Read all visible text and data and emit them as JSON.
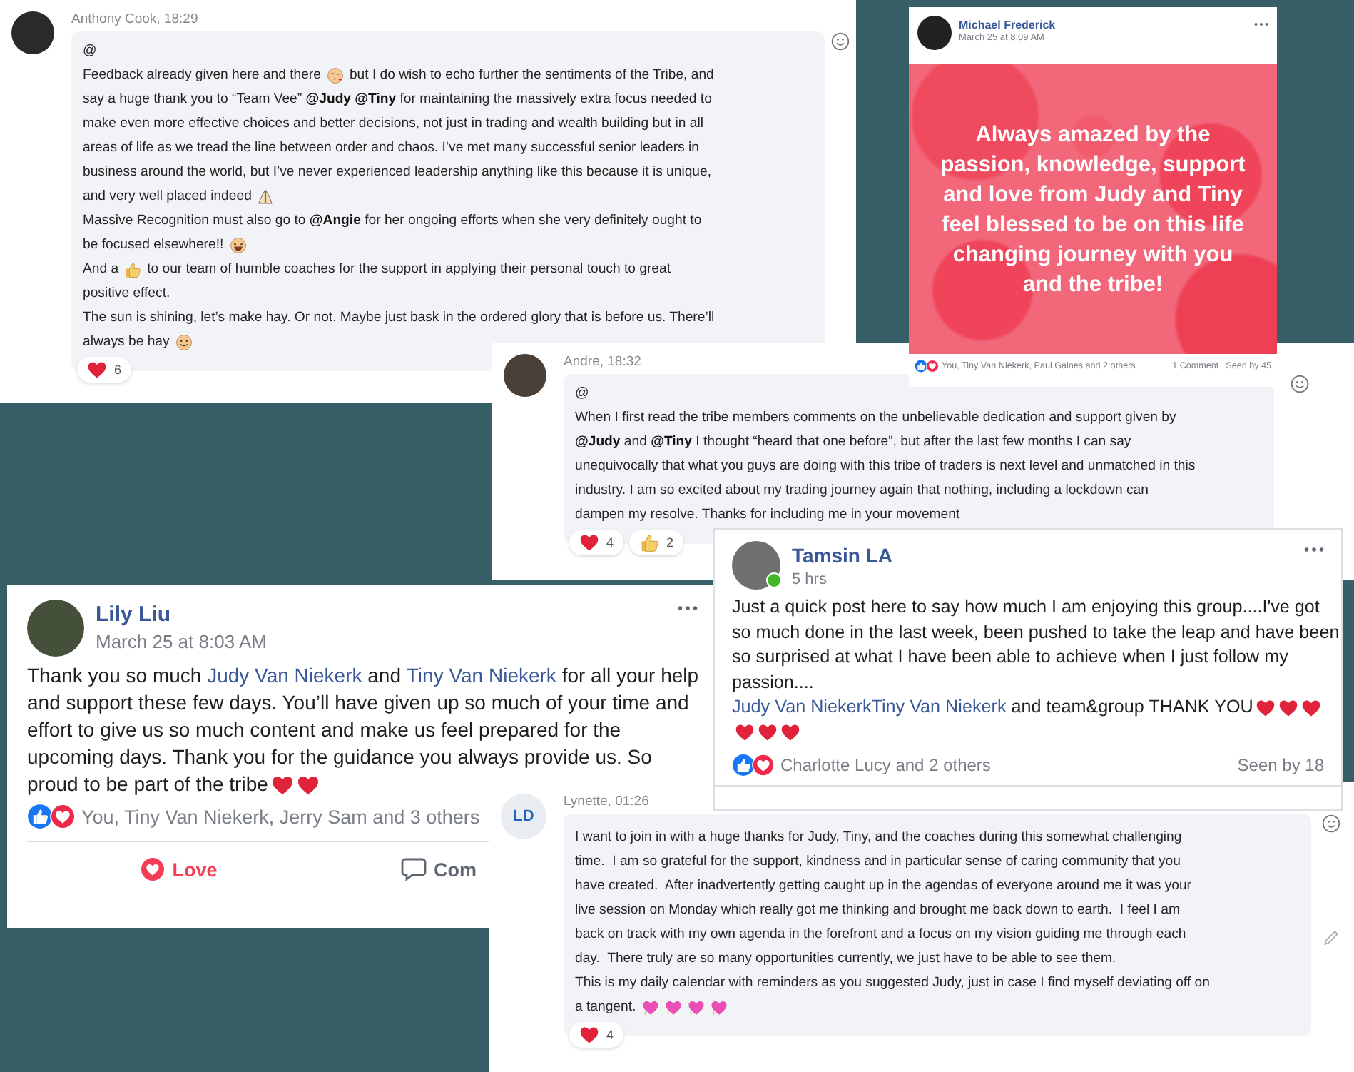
{
  "posts": [
    {
      "kind": "chat",
      "author": "Anthony Cook, 18:29",
      "lines": [
        [
          {
            "kind": "text",
            "text": "@"
          }
        ],
        [
          {
            "kind": "text",
            "text": "Feedback already given here and there"
          },
          {
            "kind": "kiss"
          },
          {
            "kind": "text",
            "text": "but I do wish to echo further the sentiments of the Tribe, and"
          }
        ],
        [
          {
            "kind": "text",
            "text": "say a huge thank you to “Team Vee” **@Judy @Tiny** for maintaining the massively extra focus needed to"
          }
        ],
        [
          {
            "kind": "text",
            "text": "make even more effective choices and better decisions, not just in trading and wealth building but in all"
          }
        ],
        [
          {
            "kind": "text",
            "text": "areas of life as we tread the line between order and chaos. I’ve met many successful senior leaders in"
          }
        ],
        [
          {
            "kind": "text",
            "text": "business around the world, but I’ve never experienced leadership anything like this because it is unique,"
          }
        ],
        [
          {
            "kind": "text",
            "text": "and very well placed indeed"
          },
          {
            "kind": "pray"
          }
        ],
        [
          {
            "kind": "text",
            "text": "Massive Recognition must also go to **@Angie** for her ongoing efforts when she very definitely ought to"
          }
        ],
        [
          {
            "kind": "text",
            "text": "be focused elsewhere!!"
          },
          {
            "kind": "laugh"
          }
        ],
        [
          {
            "kind": "text",
            "text": "And a"
          },
          {
            "kind": "thumb"
          },
          {
            "kind": "text",
            "text": "to our team of humble coaches for the support in applying their personal touch to great"
          }
        ],
        [
          {
            "kind": "text",
            "text": "positive effect."
          }
        ],
        [
          {
            "kind": "text",
            "text": "The sun is shining, let’s make hay. Or not. Maybe just bask in the ordered glory that is before us. There’ll"
          }
        ],
        [
          {
            "kind": "text",
            "text": "always be hay"
          },
          {
            "kind": "smile"
          }
        ]
      ],
      "reactions": [
        {
          "kind": "heart",
          "count": "6"
        }
      ]
    },
    {
      "kind": "chat",
      "author": "Andre, 18:32",
      "lines": [
        [
          {
            "kind": "text",
            "text": "@"
          }
        ],
        [
          {
            "kind": "text",
            "text": "When I first read the tribe members comments on the unbelievable dedication and support given by"
          }
        ],
        [
          {
            "kind": "text",
            "text": "**@Judy** and **@Tiny** I thought “heard that one before”, but after the last few months I can say"
          }
        ],
        [
          {
            "kind": "text",
            "text": "unequivocally that what you guys are doing with this tribe of traders is next level and unmatched in this"
          }
        ],
        [
          {
            "kind": "text",
            "text": "industry. I am so excited about my trading journey again that nothing, including a lockdown can"
          }
        ],
        [
          {
            "kind": "text",
            "text": "dampen my resolve. Thanks for including me in your movement"
          }
        ]
      ],
      "reactions": [
        {
          "kind": "heart",
          "count": "4"
        },
        {
          "kind": "thumb",
          "count": "2"
        }
      ]
    },
    {
      "kind": "card",
      "author": "Michael Frederick",
      "time": "March 25 at 8:09 AM",
      "banner": "Always amazed by the passion, knowledge, support and love from Judy and Tiny feel blessed to be on this life changing journey with you and the tribe!",
      "likers": "You, Tiny Van Niekerk, Paul Gaines and 2 others",
      "comments": "1 Comment",
      "seen": "Seen by 45"
    },
    {
      "kind": "card",
      "author": "Tamsin LA",
      "time": "5 hrs",
      "online": true,
      "lines": [
        [
          {
            "kind": "text",
            "text": "Just a quick post here to say how much I am enjoying this group....I've got"
          }
        ],
        [
          {
            "kind": "text",
            "text": "so much done in the last week, been pushed to take the leap and have been"
          }
        ],
        [
          {
            "kind": "text",
            "text": "so surprised at what I have been able to achieve when I just follow my"
          }
        ],
        [
          {
            "kind": "text",
            "text": "passion...."
          }
        ],
        [
          {
            "kind": "link",
            "text": "Judy Van Niekerk"
          },
          {
            "kind": "link",
            "text": "Tiny Van Niekerk"
          },
          {
            "kind": "text",
            "text": " and team&group THANK YOU"
          },
          {
            "kind": "heart"
          },
          {
            "kind": "heart"
          },
          {
            "kind": "heart"
          }
        ],
        [
          {
            "kind": "heart"
          },
          {
            "kind": "heart"
          },
          {
            "kind": "heart"
          }
        ]
      ],
      "likers": "Charlotte Lucy and 2 others",
      "seen": "Seen by 18"
    },
    {
      "kind": "card",
      "author": "Lily Liu",
      "time": "March 25 at 8:03 AM",
      "lines": [
        [
          {
            "kind": "text",
            "text": "Thank you so much "
          },
          {
            "kind": "link",
            "text": "Judy Van Niekerk"
          },
          {
            "kind": "text",
            "text": " and "
          },
          {
            "kind": "link",
            "text": "Tiny Van Niekerk"
          },
          {
            "kind": "text",
            "text": " for all your help"
          }
        ],
        [
          {
            "kind": "text",
            "text": "and support these few days. You’ll have given up so much of your time and"
          }
        ],
        [
          {
            "kind": "text",
            "text": "effort to give us so much content and make us feel prepared for the"
          }
        ],
        [
          {
            "kind": "text",
            "text": "upcoming days. Thank you for the guidance you always provide us. So"
          }
        ],
        [
          {
            "kind": "text",
            "text": "proud to be part of the tribe"
          },
          {
            "kind": "heart"
          },
          {
            "kind": "heart"
          }
        ]
      ],
      "likers": "You, Tiny Van Niekerk, Jerry Sam and 3 others",
      "actions": [
        {
          "kind": "love",
          "label": "Love",
          "selected": true
        },
        {
          "kind": "comment",
          "label": "Com",
          "selected": false
        }
      ]
    },
    {
      "kind": "chat",
      "author": "Lynette, 01:26",
      "initials": "LD",
      "lines": [
        [
          {
            "kind": "text",
            "text": "I want to join in with a huge thanks for Judy, Tiny, and the coaches during this somewhat challenging"
          }
        ],
        [
          {
            "kind": "text",
            "text": "time.  I am so grateful for the support, kindness and in particular sense of caring community that you"
          }
        ],
        [
          {
            "kind": "text",
            "text": "have created.  After inadvertently getting caught up in the agendas of everyone around me it was your"
          }
        ],
        [
          {
            "kind": "text",
            "text": "live session on Monday which really got me thinking and brought me back down to earth.  I feel I am"
          }
        ],
        [
          {
            "kind": "text",
            "text": "back on track with my own agenda in the forefront and a focus on my vision guiding me through each"
          }
        ],
        [
          {
            "kind": "text",
            "text": "day.  There truly are so many opportunities currently, we just have to be able to see them."
          }
        ],
        [
          {
            "kind": "text",
            "text": "This is my daily calendar with reminders as you suggested Judy, just in case I find myself deviating off on"
          }
        ],
        [
          {
            "kind": "text",
            "text": "a tangent."
          },
          {
            "kind": "sparkle"
          },
          {
            "kind": "sparkle"
          },
          {
            "kind": "sparkle"
          },
          {
            "kind": "sparkle"
          }
        ]
      ],
      "reactions": [
        {
          "kind": "heart",
          "count": "4"
        }
      ],
      "editable": true
    }
  ]
}
